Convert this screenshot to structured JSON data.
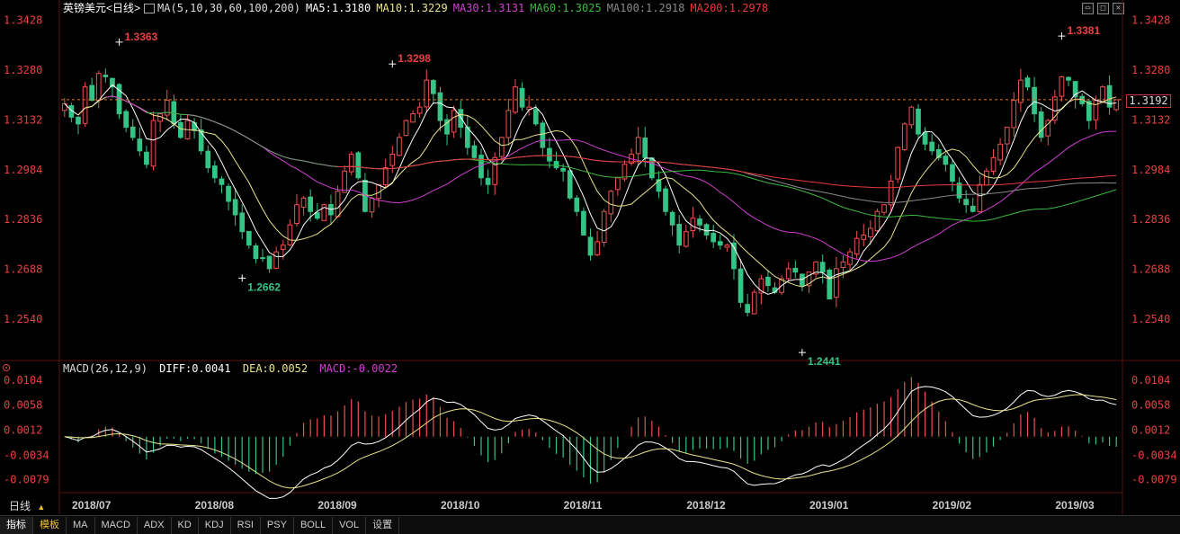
{
  "legend": {
    "title": "英镑美元<日线>",
    "ma_label": "MA(5,10,30,60,100,200)",
    "ma5": "MA5:1.3180",
    "ma10": "MA10:1.3229",
    "ma30": "MA30:1.3131",
    "ma60": "MA60:1.3025",
    "ma100": "MA100:1.2918",
    "ma200": "MA200:1.2978"
  },
  "macd_legend": {
    "label": "MACD(26,12,9)",
    "diff": "DIFF:0.0041",
    "dea": "DEA:0.0052",
    "macd": "MACD:-0.0022"
  },
  "colors": {
    "up": "#f05050",
    "down": "#34c486",
    "ma5": "#ffffff",
    "ma10": "#e8e48a",
    "ma30": "#d040d0",
    "ma60": "#3cb83c",
    "ma100": "#8a8a8a",
    "ma200": "#e83a3a",
    "axis_text": "#e84040",
    "grid": "#5a1010"
  },
  "current_price": "1.3192",
  "period_button": "日线",
  "tabs": [
    "指标",
    "模板",
    "MA",
    "MACD",
    "ADX",
    "KD",
    "KDJ",
    "RSI",
    "PSY",
    "BOLL",
    "VOL",
    "设置"
  ],
  "chart_data": {
    "type": "candlestick",
    "price_axis_ticks": [
      1.3428,
      1.328,
      1.3132,
      1.2984,
      1.2836,
      1.2688,
      1.254
    ],
    "price_axis_labels": [
      "1.3428",
      "1.3280",
      "1.3132",
      "1.2984",
      "1.2836",
      "1.2688",
      "1.2540"
    ],
    "macd_axis_ticks": [
      0.0104,
      0.0058,
      0.0012,
      -0.0034,
      -0.0079
    ],
    "macd_axis_labels": [
      "0.0104",
      "0.0058",
      "0.0012",
      "-0.0034",
      "-0.0079"
    ],
    "x_labels": [
      "2018/07",
      "2018/08",
      "2018/09",
      "2018/10",
      "2018/11",
      "2018/12",
      "2019/01",
      "2019/02",
      "2019/03"
    ],
    "annotations": [
      {
        "label": "1.3363",
        "value": 1.3363,
        "bar_fraction": 0.05,
        "color": "#e84040"
      },
      {
        "label": "1.3298",
        "value": 1.3298,
        "bar_fraction": 0.31,
        "color": "#e84040"
      },
      {
        "label": "1.2662",
        "value": 1.2662,
        "bar_fraction": 0.17,
        "color": "#34c486"
      },
      {
        "label": "1.2441",
        "value": 1.2441,
        "bar_fraction": 0.7,
        "color": "#34c486"
      },
      {
        "label": "1.3381",
        "value": 1.3381,
        "bar_fraction": 0.95,
        "color": "#e84040"
      }
    ],
    "close_series": [
      1.318,
      1.314,
      1.312,
      1.323,
      1.319,
      1.327,
      1.326,
      1.323,
      1.315,
      1.311,
      1.308,
      1.304,
      1.3,
      1.313,
      1.315,
      1.319,
      1.312,
      1.308,
      1.313,
      1.31,
      1.304,
      1.299,
      1.296,
      1.294,
      1.289,
      1.285,
      1.28,
      1.276,
      1.272,
      1.272,
      1.269,
      1.274,
      1.276,
      1.282,
      1.288,
      1.29,
      1.286,
      1.284,
      1.288,
      1.285,
      1.292,
      1.298,
      1.303,
      1.296,
      1.286,
      1.29,
      1.294,
      1.299,
      1.303,
      1.308,
      1.313,
      1.315,
      1.317,
      1.325,
      1.321,
      1.313,
      1.309,
      1.316,
      1.311,
      1.305,
      1.302,
      1.296,
      1.294,
      1.302,
      1.308,
      1.316,
      1.323,
      1.317,
      1.317,
      1.312,
      1.305,
      1.301,
      1.299,
      1.298,
      1.29,
      1.286,
      1.279,
      1.273,
      1.277,
      1.286,
      1.292,
      1.296,
      1.3,
      1.303,
      1.308,
      1.302,
      1.296,
      1.292,
      1.286,
      1.282,
      1.276,
      1.28,
      1.284,
      1.282,
      1.279,
      1.277,
      1.276,
      1.276,
      1.269,
      1.259,
      1.256,
      1.262,
      1.266,
      1.264,
      1.262,
      1.266,
      1.269,
      1.268,
      1.264,
      1.268,
      1.271,
      1.268,
      1.26,
      1.269,
      1.271,
      1.274,
      1.278,
      1.279,
      1.281,
      1.286,
      1.288,
      1.295,
      1.305,
      1.312,
      1.317,
      1.309,
      1.306,
      1.304,
      1.302,
      1.3,
      1.295,
      1.29,
      1.288,
      1.286,
      1.294,
      1.298,
      1.302,
      1.306,
      1.311,
      1.319,
      1.325,
      1.323,
      1.315,
      1.308,
      1.313,
      1.32,
      1.326,
      1.325,
      1.32,
      1.318,
      1.313,
      1.319,
      1.323,
      1.317,
      1.3192
    ],
    "ma_last_values": {
      "ma5": 1.318,
      "ma10": 1.3229,
      "ma30": 1.3131,
      "ma60": 1.3025,
      "ma100": 1.2918,
      "ma200": 1.2978
    }
  }
}
